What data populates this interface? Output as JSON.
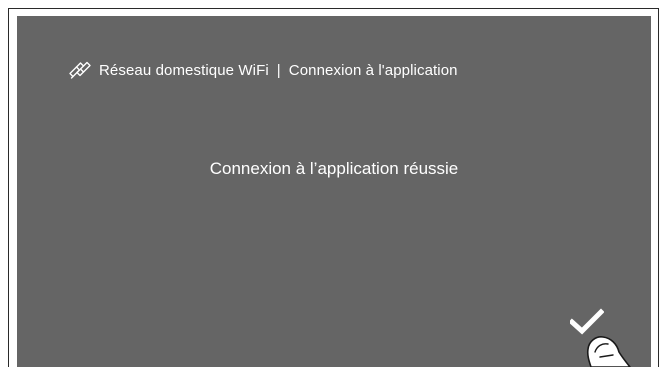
{
  "header": {
    "icon": "link-icon",
    "section": "Réseau domestique WiFi",
    "separator": "|",
    "subsection": "Connexion à l'application"
  },
  "message": "Connexion à l’application réussie",
  "confirm_button": {
    "icon": "checkmark-icon"
  },
  "hint": {
    "icon": "finger-tap-icon"
  },
  "colors": {
    "screen_background": "#656565",
    "text": "#ffffff",
    "frame_border": "#2a2a2a"
  }
}
